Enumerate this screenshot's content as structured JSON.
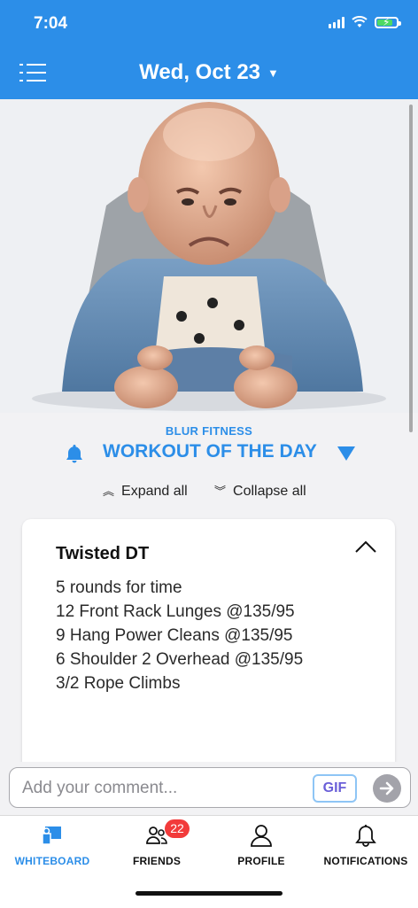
{
  "status_bar": {
    "time": "7:04"
  },
  "header": {
    "date": "Wed, Oct 23",
    "caret": "▼"
  },
  "workout": {
    "gym_name": "BLUR FITNESS",
    "section_title": "WORKOUT OF THE DAY",
    "expand_label": "Expand all",
    "collapse_label": "Collapse all",
    "card": {
      "title": "Twisted DT",
      "lines": [
        "5 rounds for time",
        "12 Front Rack Lunges @135/95",
        "9 Hang Power Cleans @135/95",
        "6 Shoulder 2 Overhead @135/95",
        "3/2 Rope Climbs"
      ]
    }
  },
  "comment": {
    "placeholder": "Add your comment...",
    "gif_label": "GIF"
  },
  "tabs": [
    {
      "label": "WHITEBOARD",
      "icon": "whiteboard-icon",
      "active": true
    },
    {
      "label": "FRIENDS",
      "icon": "friends-icon",
      "badge": "22"
    },
    {
      "label": "PROFILE",
      "icon": "profile-icon"
    },
    {
      "label": "NOTIFICATIONS",
      "icon": "bell-icon"
    }
  ],
  "colors": {
    "accent": "#2c8ee8",
    "badge": "#f23b3b",
    "background": "#f2f2f4"
  },
  "hero_image": {
    "icon": "hero-photo"
  }
}
